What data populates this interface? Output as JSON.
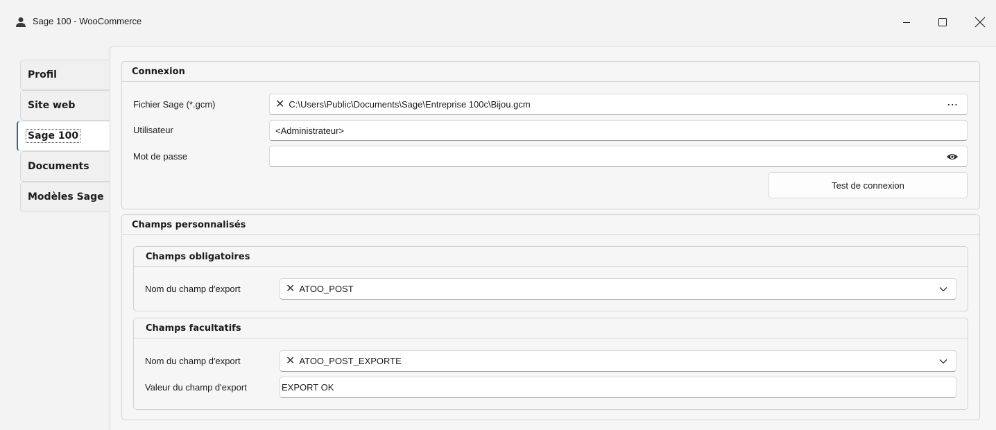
{
  "window": {
    "title": "Sage 100 - WooCommerce",
    "icons": [
      "user-icon",
      "minimize-icon",
      "maximize-icon",
      "close-icon"
    ]
  },
  "tabs": [
    {
      "label": "Profil",
      "active": false
    },
    {
      "label": "Site web",
      "active": false
    },
    {
      "label": "Sage 100",
      "active": true
    },
    {
      "label": "Documents",
      "active": false
    },
    {
      "label": "Modèles Sage",
      "active": false
    }
  ],
  "connexion": {
    "title": "Connexion",
    "fichier_label": "Fichier Sage (*.gcm)",
    "fichier_value": "C:\\Users\\Public\\Documents\\Sage\\Entreprise 100c\\Bijou.gcm",
    "fichier_browse": "···",
    "utilisateur_label": "Utilisateur",
    "utilisateur_value": "<Administrateur>",
    "motdepasse_label": "Mot de passe",
    "motdepasse_value": "",
    "test_button": "Test de connexion"
  },
  "champs": {
    "title": "Champs personnalisés",
    "obligatoires": {
      "title": "Champs obligatoires",
      "nom_label": "Nom du champ d'export",
      "nom_value": "ATOO_POST"
    },
    "facultatifs": {
      "title": "Champs facultatifs",
      "nom_label": "Nom du champ d'export",
      "nom_value": "ATOO_POST_EXPORTE",
      "valeur_label": "Valeur du champ d'export",
      "valeur_value": "EXPORT OK"
    }
  }
}
